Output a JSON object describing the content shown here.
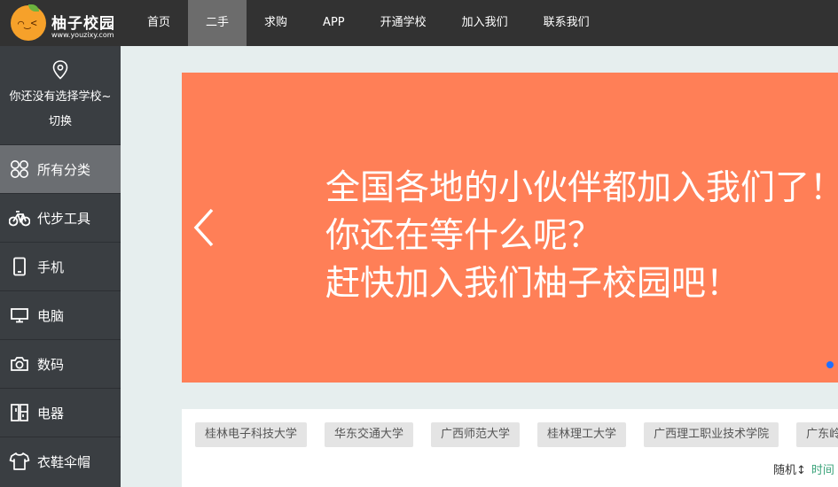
{
  "logo": {
    "name": "柚子校园",
    "url": "www.youzixy.com",
    "icon": "orange-logo-icon"
  },
  "nav": {
    "items": [
      {
        "label": "首页",
        "active": false
      },
      {
        "label": "二手",
        "active": true
      },
      {
        "label": "求购",
        "active": false
      },
      {
        "label": "APP",
        "active": false
      },
      {
        "label": "开通学校",
        "active": false
      },
      {
        "label": "加入我们",
        "active": false
      },
      {
        "label": "联系我们",
        "active": false
      }
    ]
  },
  "sidebar": {
    "school_notice": "你还没有选择学校~",
    "switch_label": "切换",
    "categories": [
      {
        "label": "所有分类",
        "icon": "grid-icon",
        "active": true
      },
      {
        "label": "代步工具",
        "icon": "bicycle-icon",
        "active": false
      },
      {
        "label": "手机",
        "icon": "phone-icon",
        "active": false
      },
      {
        "label": "电脑",
        "icon": "monitor-icon",
        "active": false
      },
      {
        "label": "数码",
        "icon": "camera-icon",
        "active": false
      },
      {
        "label": "电器",
        "icon": "fridge-icon",
        "active": false
      },
      {
        "label": "衣鞋伞帽",
        "icon": "tshirt-icon",
        "active": false
      }
    ]
  },
  "banner": {
    "lines": [
      "全国各地的小伙伴都加入我们了！",
      "你还在等什么呢？",
      "赶快加入我们柚子校园吧！"
    ],
    "background": "#ff7f57",
    "dot_color": "#1e6fff"
  },
  "schools": {
    "tags": [
      "桂林电子科技大学",
      "华东交通大学",
      "广西师范大学",
      "桂林理工大学",
      "广西理工职业技术学院",
      "广东岭南"
    ],
    "sort_random": "随机",
    "sort_time": "时间"
  },
  "colors": {
    "topbar": "#323232",
    "sidebar": "#3a3e42",
    "accent_green": "#3aa37a"
  }
}
